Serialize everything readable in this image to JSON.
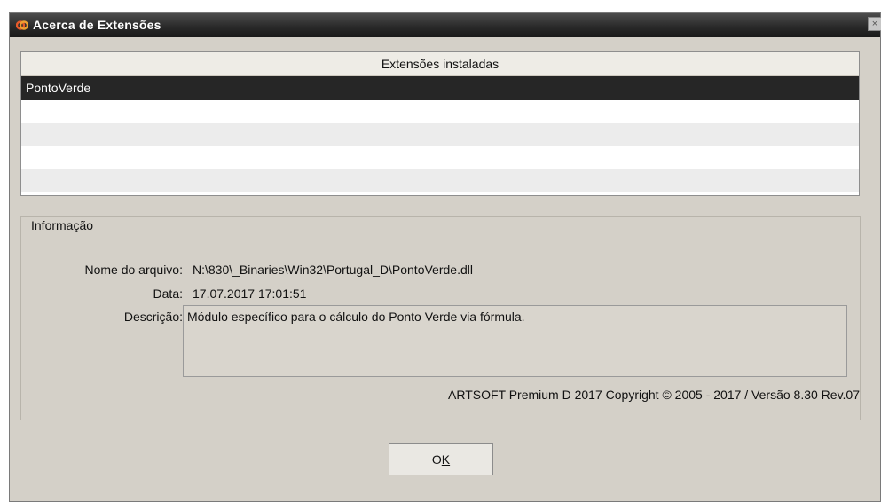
{
  "window": {
    "title": "Acerca de Extensões",
    "close_label": "×"
  },
  "extensions": {
    "header": "Extensões instaladas",
    "rows": [
      "PontoVerde",
      "",
      "",
      "",
      ""
    ]
  },
  "info": {
    "legend": "Informação",
    "file_label": "Nome do arquivo:",
    "file_value": "N:\\830\\_Binaries\\Win32\\Portugal_D\\PontoVerde.dll",
    "date_label": "Data:",
    "date_value": "17.07.2017 17:01:51",
    "desc_label": "Descrição:",
    "desc_value": "Módulo específico para o cálculo do Ponto Verde via fórmula.",
    "copyright": "ARTSOFT Premium D 2017 Copyright © 2005 - 2017 / Versão 8.30 Rev.07"
  },
  "buttons": {
    "ok_prefix": "O",
    "ok_underlined": "K"
  },
  "icons": {
    "app": "app-logo-icon",
    "close": "close-icon"
  },
  "colors": {
    "titlebar": "#2a2a2a",
    "dialog_bg": "#d4d0c8",
    "selection": "#262626"
  }
}
